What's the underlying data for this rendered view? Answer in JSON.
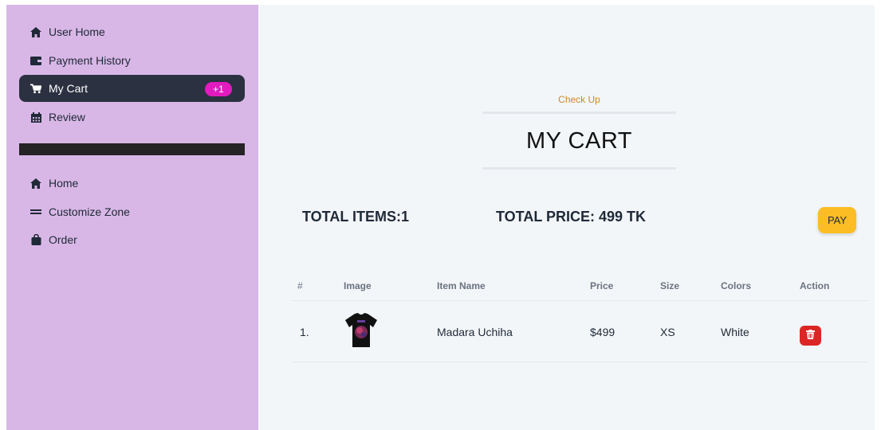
{
  "sidebar": {
    "items": [
      {
        "label": "User Home",
        "icon": "home-icon"
      },
      {
        "label": "Payment History",
        "icon": "wallet-icon"
      },
      {
        "label": "My Cart",
        "icon": "cart-icon",
        "badge": "+1",
        "active": true
      },
      {
        "label": "Review",
        "icon": "calendar-icon"
      }
    ],
    "items2": [
      {
        "label": "Home",
        "icon": "home-icon"
      },
      {
        "label": "Customize Zone",
        "icon": "equals-icon"
      },
      {
        "label": "Order",
        "icon": "bag-icon"
      }
    ]
  },
  "main": {
    "subtitle": "Check Up",
    "title": "MY CART",
    "total_items": "TOTAL ITEMS:1",
    "total_price": "TOTAL PRICE: 499 TK",
    "pay_label": "PAY"
  },
  "table": {
    "headers": [
      "#",
      "Image",
      "Item Name",
      "Price",
      "Size",
      "Colors",
      "Action"
    ],
    "rows": [
      {
        "index": "1.",
        "image": "black t-shirt with Madara Uchiha print",
        "name": "Madara Uchiha",
        "price": "$499",
        "size": "XS",
        "color": "White"
      }
    ]
  },
  "colors": {
    "sidebar_bg": "#d8b7e6",
    "active_item_bg": "#2b3140",
    "badge_bg": "#e21bbf",
    "pay_button": "#fbbd23",
    "delete_button": "#dc2626",
    "subtitle_color": "#c98b1c"
  }
}
